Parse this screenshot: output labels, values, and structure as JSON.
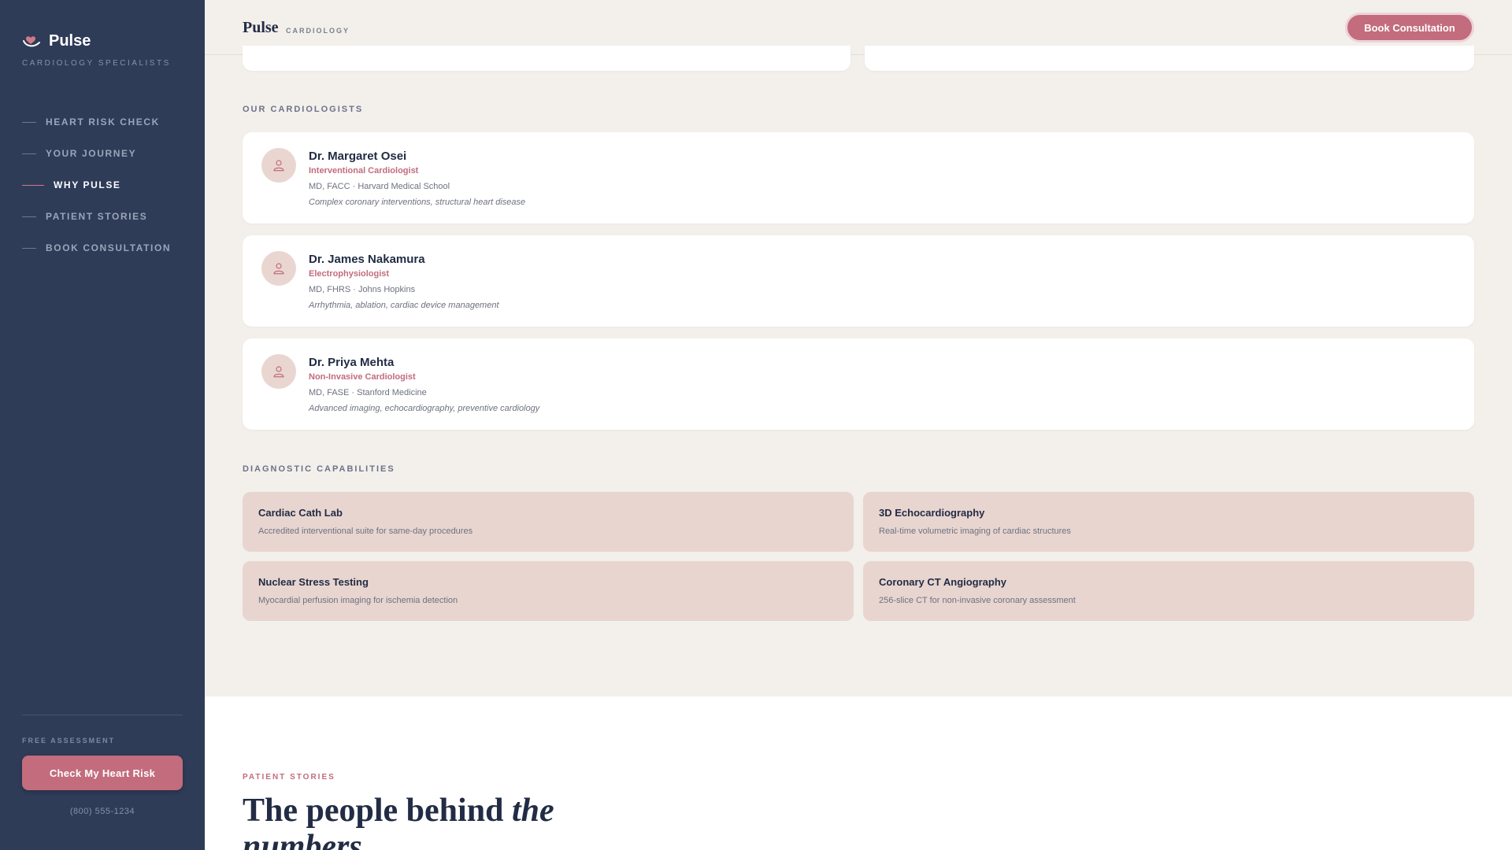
{
  "sidebar": {
    "brand": "Pulse",
    "subtitle": "CARDIOLOGY SPECIALISTS",
    "nav": [
      {
        "label": "HEART RISK CHECK",
        "active": false
      },
      {
        "label": "YOUR JOURNEY",
        "active": false
      },
      {
        "label": "WHY PULSE",
        "active": true
      },
      {
        "label": "PATIENT STORIES",
        "active": false
      },
      {
        "label": "BOOK CONSULTATION",
        "active": false
      }
    ],
    "free_label": "FREE ASSESSMENT",
    "cta_label": "Check My Heart Risk",
    "phone": "(800) 555-1234"
  },
  "header": {
    "logo": "Pulse",
    "tag": "CARDIOLOGY",
    "cta_label": "Book Consultation"
  },
  "cardiologists": {
    "label": "OUR CARDIOLOGISTS",
    "items": [
      {
        "name": "Dr. Margaret Osei",
        "role": "Interventional Cardiologist",
        "creds": "MD, FACC · Harvard Medical School",
        "focus": "Complex coronary interventions, structural heart disease"
      },
      {
        "name": "Dr. James Nakamura",
        "role": "Electrophysiologist",
        "creds": "MD, FHRS · Johns Hopkins",
        "focus": "Arrhythmia, ablation, cardiac device management"
      },
      {
        "name": "Dr. Priya Mehta",
        "role": "Non-Invasive Cardiologist",
        "creds": "MD, FASE · Stanford Medicine",
        "focus": "Advanced imaging, echocardiography, preventive cardiology"
      }
    ]
  },
  "capabilities": {
    "label": "DIAGNOSTIC CAPABILITIES",
    "items": [
      {
        "title": "Cardiac Cath Lab",
        "desc": "Accredited interventional suite for same-day procedures"
      },
      {
        "title": "3D Echocardiography",
        "desc": "Real-time volumetric imaging of cardiac structures"
      },
      {
        "title": "Nuclear Stress Testing",
        "desc": "Myocardial perfusion imaging for ischemia detection"
      },
      {
        "title": "Coronary CT Angiography",
        "desc": "256-slice CT for non-invasive coronary assessment"
      }
    ]
  },
  "stories": {
    "label": "PATIENT STORIES",
    "title_plain": "The people behind ",
    "title_em": "the numbers"
  },
  "colors": {
    "sidebar_bg": "#2f3c58",
    "accent": "#c26c7d",
    "page_bg": "#f3efeb",
    "capability_bg": "#e8d5d0"
  },
  "icons": {
    "brand": "heart-hand-icon",
    "avatar": "user-icon"
  }
}
